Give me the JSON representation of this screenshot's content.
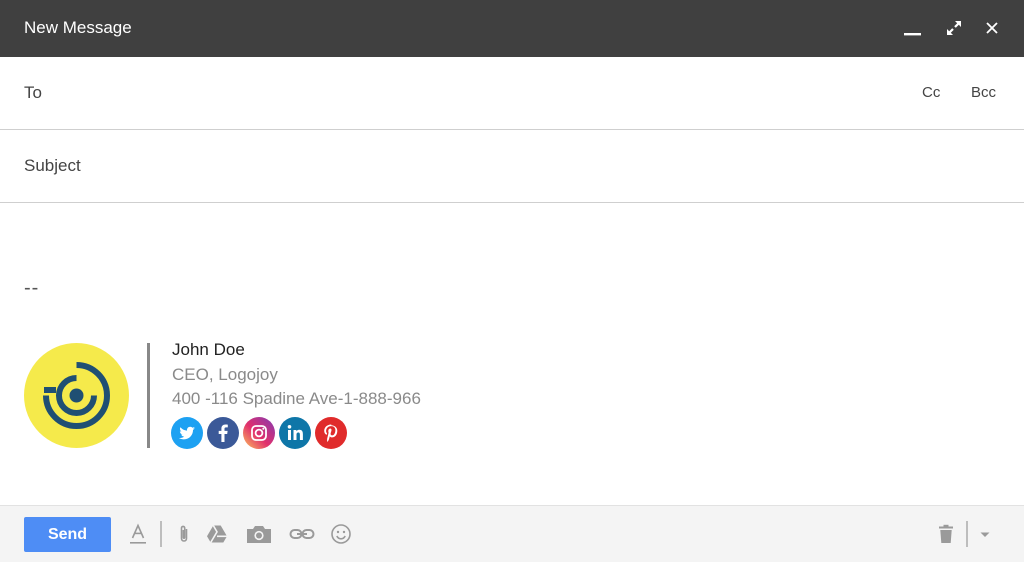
{
  "window": {
    "title": "New Message",
    "controls": [
      "minimize-icon",
      "expand-icon",
      "close-icon"
    ]
  },
  "recipients": {
    "label": "To",
    "value": "",
    "cc_label": "Cc",
    "bcc_label": "Bcc"
  },
  "subject": {
    "label": "Subject",
    "value": ""
  },
  "signature": {
    "separator": "--",
    "name": "John Doe",
    "title": "CEO, Logojoy",
    "address": "400 -116 Spadine Ave-1-888-966",
    "logo_color": "#f5ea4b",
    "logo_ring_color": "#1f4f73",
    "socials": [
      {
        "name": "twitter-icon",
        "color": "#1da1f2"
      },
      {
        "name": "facebook-icon",
        "color": "#3b5998"
      },
      {
        "name": "instagram-icon",
        "color": "#c13584"
      },
      {
        "name": "linkedin-icon",
        "color": "#0e76a8"
      },
      {
        "name": "pinterest-icon",
        "color": "#e02b2b"
      }
    ]
  },
  "footer": {
    "send_label": "Send",
    "send_color": "#4e8df5",
    "tools": [
      "format-text-icon",
      "attachment-icon",
      "google-drive-icon",
      "photo-icon",
      "link-icon",
      "emoji-icon"
    ],
    "right_tools": [
      "trash-icon",
      "more-options-dropdown-icon"
    ]
  }
}
